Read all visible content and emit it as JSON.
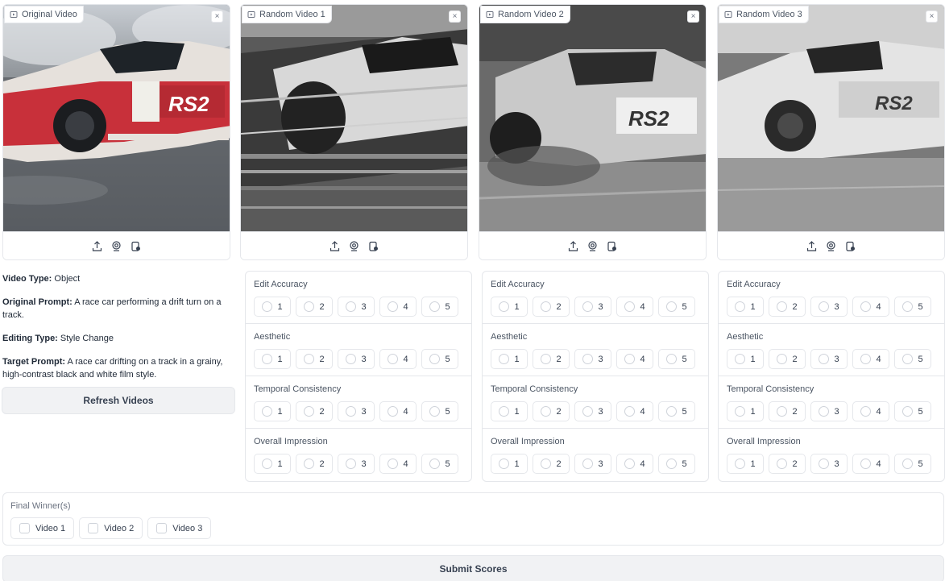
{
  "videos": [
    {
      "label": "Original Video",
      "grayscale": false
    },
    {
      "label": "Random Video 1",
      "grayscale": true
    },
    {
      "label": "Random Video 2",
      "grayscale": true
    },
    {
      "label": "Random Video 3",
      "grayscale": true
    }
  ],
  "close_glyph": "×",
  "toolbar_icons": [
    "upload-icon",
    "webcam-icon",
    "clipboard-icon"
  ],
  "info": {
    "video_type_label": "Video Type:",
    "video_type": "Object",
    "original_prompt_label": "Original Prompt:",
    "original_prompt": "A race car performing a drift turn on a track.",
    "editing_type_label": "Editing Type:",
    "editing_type": "Style Change",
    "target_prompt_label": "Target Prompt:",
    "target_prompt": "A race car drifting on a track in a grainy, high-contrast black and white film style."
  },
  "refresh_button": "Refresh Videos",
  "ratings": {
    "criteria": [
      "Edit Accuracy",
      "Aesthetic",
      "Temporal Consistency",
      "Overall Impression"
    ],
    "options": [
      "1",
      "2",
      "3",
      "4",
      "5"
    ]
  },
  "final_winner": {
    "title": "Final Winner(s)",
    "options": [
      "Video 1",
      "Video 2",
      "Video 3"
    ]
  },
  "submit_button": "Submit Scores",
  "colors": {
    "border": "#e5e7eb",
    "button_bg": "#f1f2f4",
    "text": "#1f2937",
    "muted": "#6b7280",
    "car_red": "#c8303a"
  }
}
